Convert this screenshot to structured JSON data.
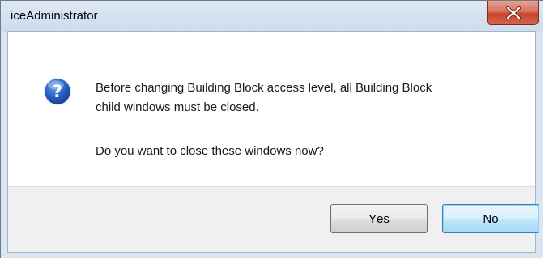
{
  "window": {
    "title": "iceAdministrator",
    "close_tooltip": "Close"
  },
  "message": {
    "icon": "question-icon",
    "line1": "Before changing Building Block access level, all Building Block",
    "line2": "child windows must be closed.",
    "line3": "Do you want to close these windows now?"
  },
  "buttons": {
    "yes_mnemonic": "Y",
    "yes_rest": "es",
    "no_label": "No"
  },
  "colors": {
    "close_button": "#c7452e",
    "default_button_border": "#3c7fb1",
    "footer_background": "#f0f0f0"
  }
}
